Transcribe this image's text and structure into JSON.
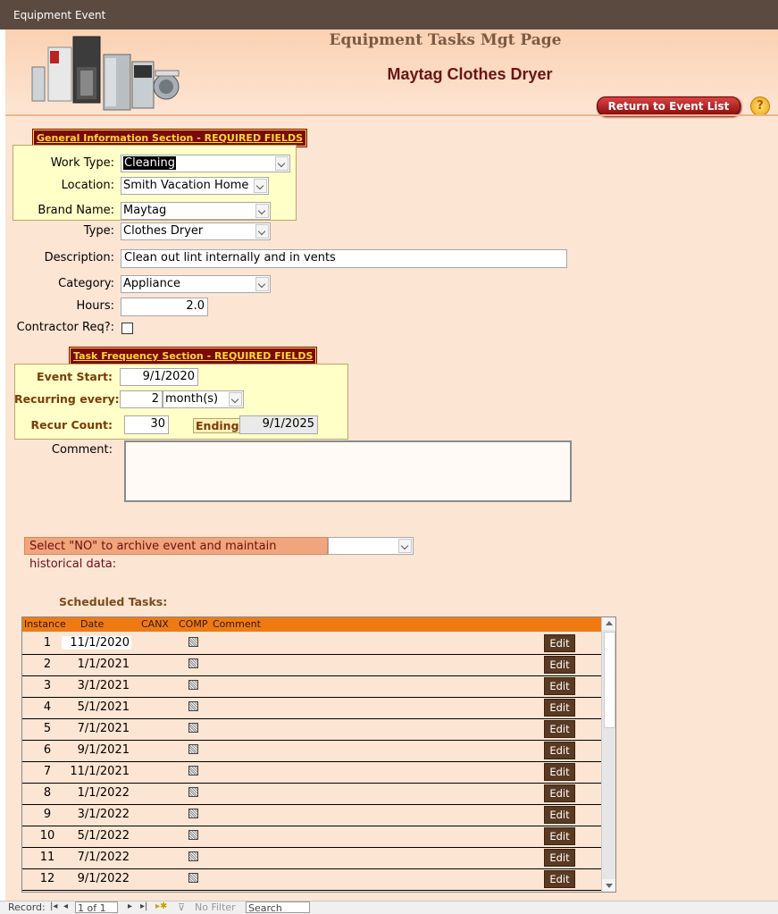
{
  "window": {
    "title": "Equipment Event"
  },
  "header": {
    "title": "Equipment Tasks Mgt Page",
    "subtitle": "Maytag Clothes Dryer",
    "return_button": "Return to Event List",
    "help_icon": "?"
  },
  "general": {
    "banner": "General Information Section - REQUIRED FIELDS",
    "work_type_label": "Work Type:",
    "work_type": "Cleaning",
    "location_label": "Location:",
    "location": "Smith Vacation Home",
    "brand_label": "Brand Name:",
    "brand": "Maytag",
    "type_label": "Type:",
    "type": "Clothes Dryer",
    "description_label": "Description:",
    "description": "Clean out lint internally and in vents",
    "category_label": "Category:",
    "category": "Appliance",
    "hours_label": "Hours:",
    "hours": "2.0",
    "contractor_label": "Contractor Req?:",
    "contractor_required": false
  },
  "frequency": {
    "banner": "Task Frequency Section  - REQUIRED FIELDS",
    "event_start_label": "Event Start:",
    "event_start": "9/1/2020",
    "recurring_label": "Recurring every:",
    "recurring_value": "2",
    "recurring_unit": "month(s)",
    "recur_count_label": "Recur Count:",
    "recur_count": "30",
    "ending_label": "Ending:",
    "ending": "9/1/2025",
    "comment_label": "Comment:",
    "comment": ""
  },
  "archive": {
    "label": "Select \"NO\" to archive event and maintain historical data:",
    "value": ""
  },
  "scheduled": {
    "label": "Scheduled Tasks:",
    "columns": [
      "Instance",
      "Date",
      "CANX",
      "COMP",
      "Comment"
    ],
    "edit_label": "Edit",
    "rows": [
      {
        "instance": "1",
        "date": "11/1/2020"
      },
      {
        "instance": "2",
        "date": "1/1/2021"
      },
      {
        "instance": "3",
        "date": "3/1/2021"
      },
      {
        "instance": "4",
        "date": "5/1/2021"
      },
      {
        "instance": "5",
        "date": "7/1/2021"
      },
      {
        "instance": "6",
        "date": "9/1/2021"
      },
      {
        "instance": "7",
        "date": "11/1/2021"
      },
      {
        "instance": "8",
        "date": "1/1/2022"
      },
      {
        "instance": "9",
        "date": "3/1/2022"
      },
      {
        "instance": "10",
        "date": "5/1/2022"
      },
      {
        "instance": "11",
        "date": "7/1/2022"
      },
      {
        "instance": "12",
        "date": "9/1/2022"
      }
    ]
  },
  "navbar": {
    "record_label": "Record:",
    "position": "1 of 1",
    "filter": "No Filter",
    "search": "Search"
  },
  "colors": {
    "titlebar": "#5b4a3f",
    "form_bg": "#fde5d3",
    "banner_bg": "#7a0a0a",
    "banner_text": "#ffd830",
    "grid_header": "#f07a12",
    "edit_button": "#5a3a22"
  }
}
